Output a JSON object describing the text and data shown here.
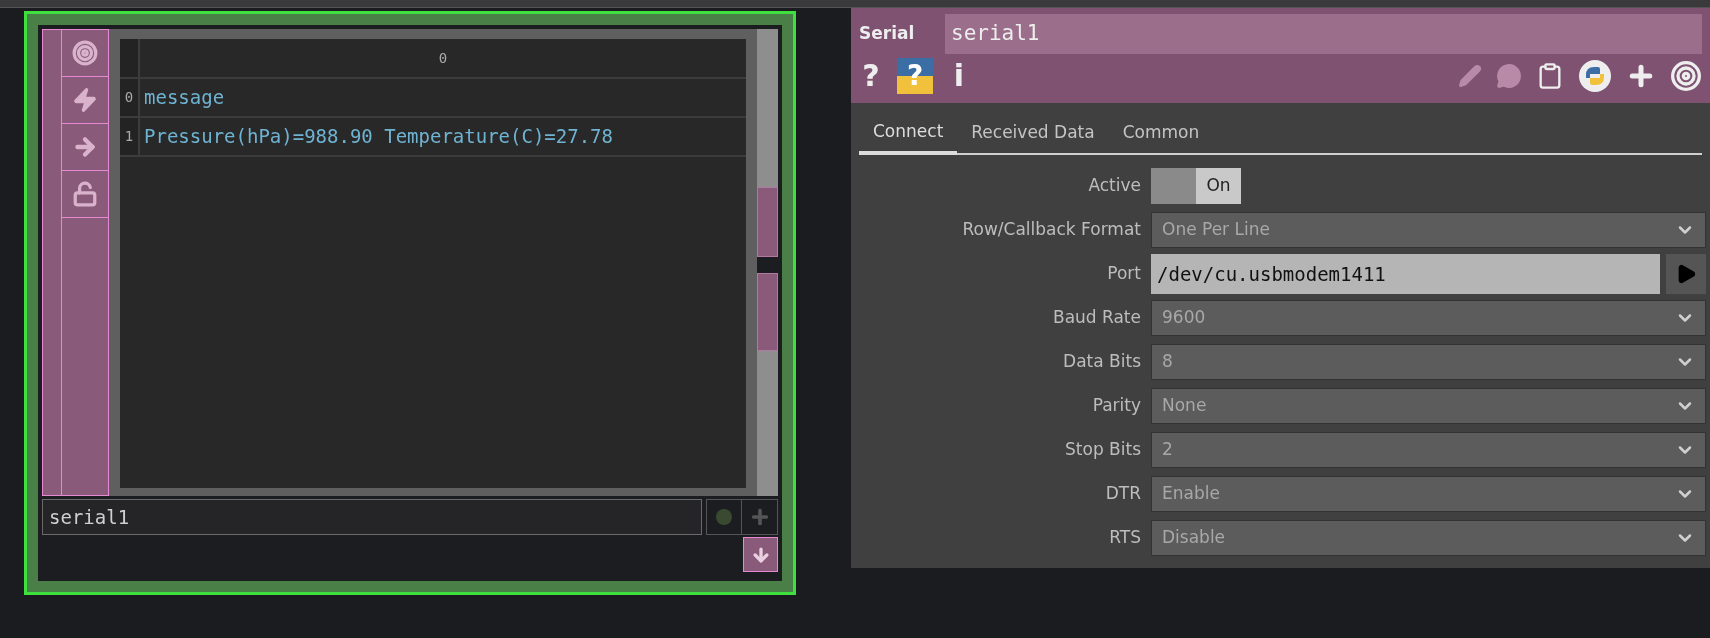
{
  "node": {
    "table": {
      "columns": [
        "0"
      ],
      "rows": [
        {
          "index": "0",
          "value": "message"
        },
        {
          "index": "1",
          "value": "Pressure(hPa)=988.90 Temperature(C)=27.78"
        }
      ]
    },
    "name": "serial1"
  },
  "panel": {
    "type_label": "Serial",
    "name": "serial1",
    "help_buttons": [
      {
        "kind": "plain",
        "glyph": "?"
      },
      {
        "kind": "python",
        "glyph": "?"
      },
      {
        "kind": "plain",
        "glyph": "i"
      }
    ],
    "tabs": [
      {
        "label": "Connect",
        "selected": true
      },
      {
        "label": "Received Data",
        "selected": false
      },
      {
        "label": "Common",
        "selected": false
      }
    ],
    "params": [
      {
        "label": "Active",
        "kind": "toggle",
        "value": "On",
        "on": true
      },
      {
        "label": "Row/Callback Format",
        "kind": "menu",
        "value": "One Per Line"
      },
      {
        "label": "Port",
        "kind": "text",
        "value": "/dev/cu.usbmodem1411"
      },
      {
        "label": "Baud Rate",
        "kind": "menu",
        "value": "9600"
      },
      {
        "label": "Data Bits",
        "kind": "menu",
        "value": "8"
      },
      {
        "label": "Parity",
        "kind": "menu",
        "value": "None"
      },
      {
        "label": "Stop Bits",
        "kind": "menu",
        "value": "2"
      },
      {
        "label": "DTR",
        "kind": "menu",
        "value": "Enable"
      },
      {
        "label": "RTS",
        "kind": "menu",
        "value": "Disable"
      }
    ]
  }
}
